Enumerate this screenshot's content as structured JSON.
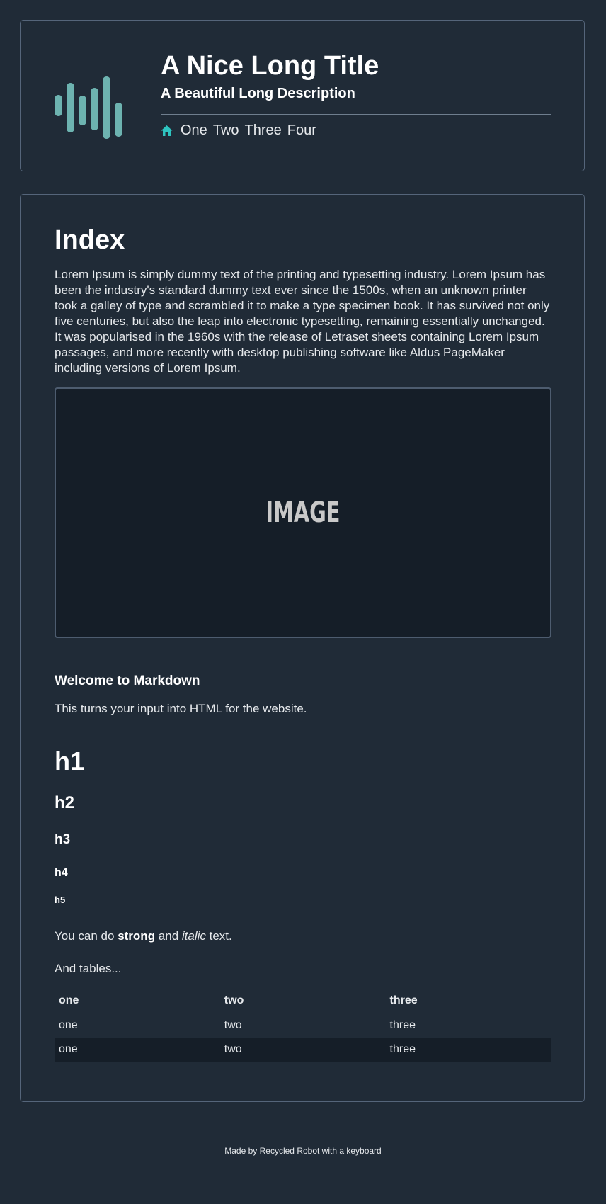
{
  "header": {
    "title": "A Nice Long Title",
    "description": "A Beautiful Long Description",
    "nav": [
      "One",
      "Two",
      "Three",
      "Four"
    ],
    "home_icon": "home-icon",
    "accent_color": "#2ec4c0",
    "logo_color": "#6db3b0"
  },
  "content": {
    "title": "Index",
    "intro": "Lorem Ipsum is simply dummy text of the printing and typesetting industry. Lorem Ipsum has been the industry's standard dummy text ever since the 1500s, when an unknown printer took a galley of type and scrambled it to make a type specimen book. It has survived not only five centuries, but also the leap into electronic typesetting, remaining essentially unchanged. It was popularised in the 1960s with the release of Letraset sheets containing Lorem Ipsum passages, and more recently with desktop publishing software like Aldus PageMaker including versions of Lorem Ipsum.",
    "image_label": "IMAGE",
    "welcome_heading": "Welcome to Markdown",
    "welcome_text": "This turns your input into HTML for the website.",
    "headings": {
      "h1": "h1",
      "h2": "h2",
      "h3": "h3",
      "h4": "h4",
      "h5": "h5"
    },
    "formatting": {
      "prefix": "You can do ",
      "strong": "strong",
      "middle": " and ",
      "italic": "italic",
      "suffix": " text."
    },
    "tables_intro": "And tables...",
    "table": {
      "headers": [
        "one",
        "two",
        "three"
      ],
      "rows": [
        [
          "one",
          "two",
          "three"
        ],
        [
          "one",
          "two",
          "three"
        ]
      ]
    }
  },
  "footer": {
    "text": "Made by Recycled Robot with a keyboard"
  }
}
